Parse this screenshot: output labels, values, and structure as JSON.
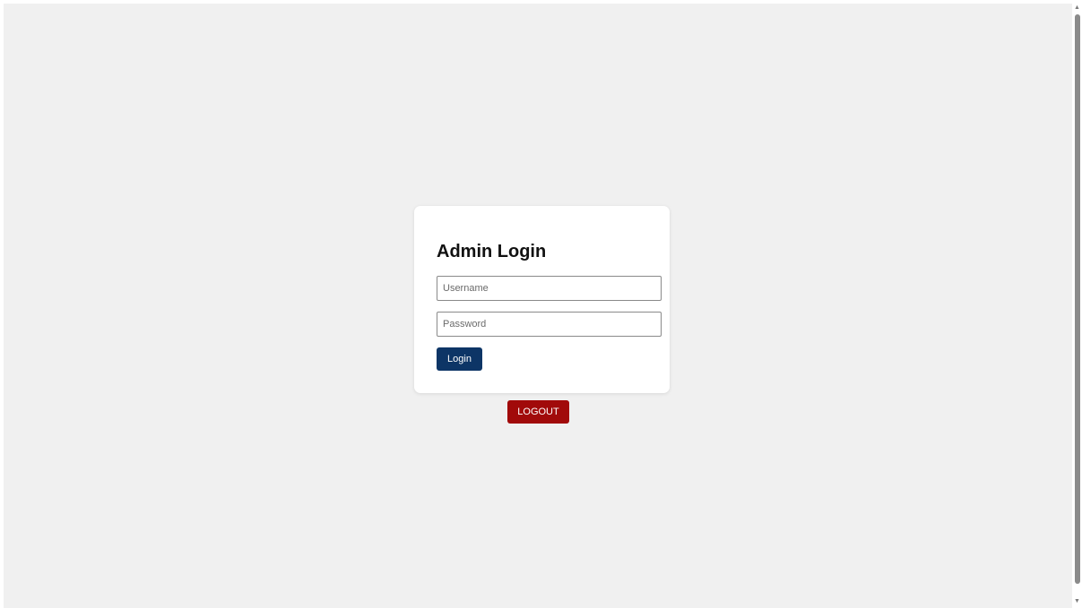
{
  "login_card": {
    "title": "Admin Login",
    "username": {
      "value": "",
      "placeholder": "Username"
    },
    "password": {
      "value": "",
      "placeholder": "Password"
    },
    "login_label": "Login"
  },
  "logout_label": "LOGOUT",
  "scrollbar": {
    "up_icon": "▲",
    "down_icon": "▼"
  },
  "colors": {
    "background": "#f0f0f0",
    "card": "#ffffff",
    "login_button": "#0d3566",
    "logout_button": "#a10a0a"
  }
}
